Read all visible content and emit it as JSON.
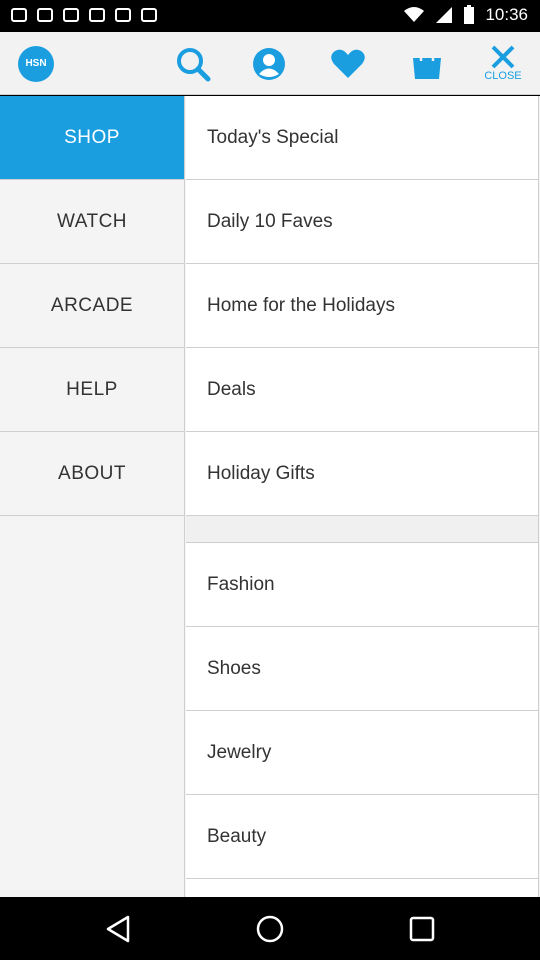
{
  "status_bar": {
    "time": "10:36",
    "left_icons": [
      "notification-icon",
      "notification-icon",
      "notification-icon",
      "notification-icon",
      "notification-icon",
      "notification-icon"
    ],
    "right_icons": [
      "wifi-icon",
      "signal-icon",
      "battery-icon"
    ]
  },
  "toolbar": {
    "logo_text": "HSN",
    "icons": [
      "search-icon",
      "profile-icon",
      "favorites-heart-icon",
      "shopping-bag-icon"
    ],
    "close_label": "CLOSE",
    "accent_color": "#1a9ee0"
  },
  "menu": {
    "categories": [
      {
        "label": "SHOP",
        "active": true
      },
      {
        "label": "WATCH",
        "active": false
      },
      {
        "label": "ARCADE",
        "active": false
      },
      {
        "label": "HELP",
        "active": false
      },
      {
        "label": "ABOUT",
        "active": false
      }
    ],
    "shop_items_top": [
      "Today's Special",
      "Daily 10 Faves",
      "Home for the Holidays",
      "Deals",
      "Holiday Gifts"
    ],
    "shop_items_bottom": [
      "Fashion",
      "Shoes",
      "Jewelry",
      "Beauty"
    ]
  },
  "nav_bar": {
    "buttons": [
      "back-icon",
      "home-icon",
      "recents-icon"
    ]
  }
}
